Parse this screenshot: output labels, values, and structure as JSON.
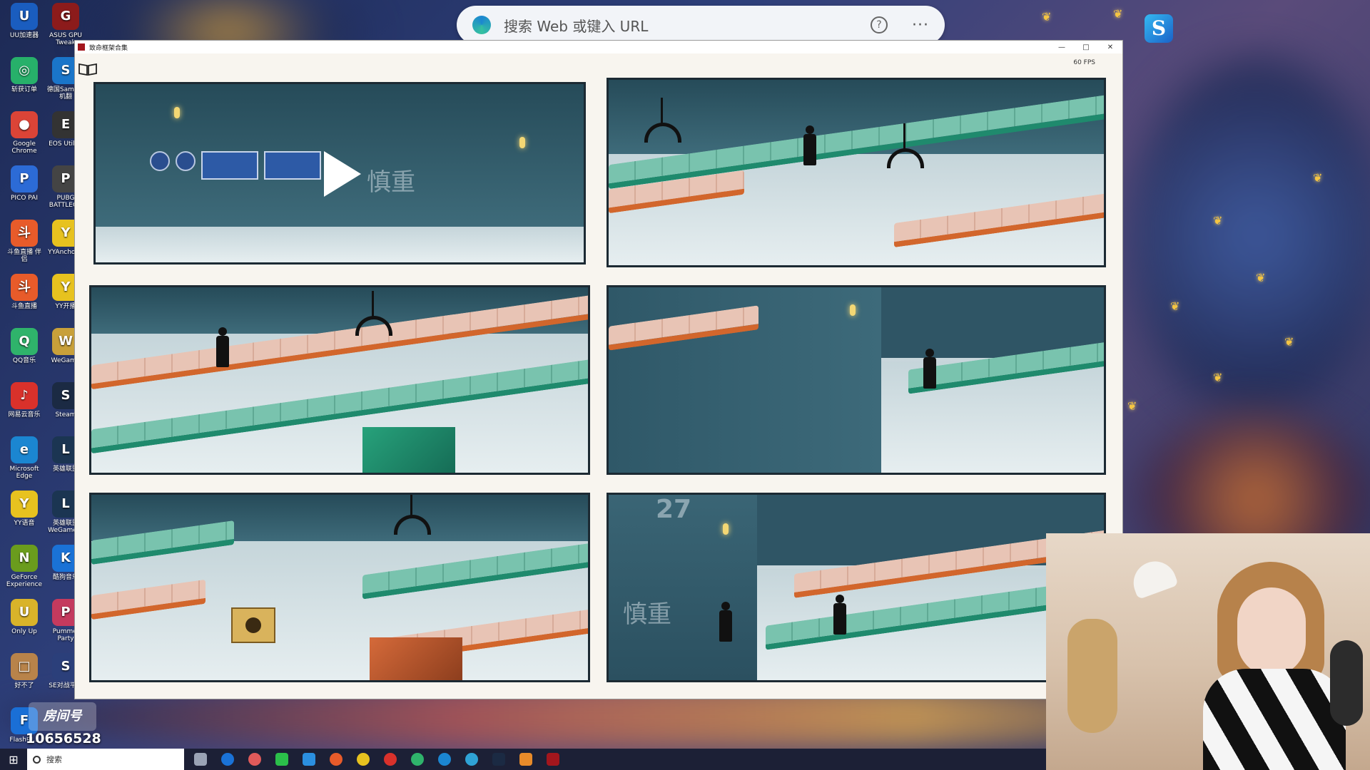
{
  "browser": {
    "address_placeholder": "搜索 Web 或键入 URL",
    "help_symbol": "?",
    "more_symbol": "···"
  },
  "desktop": {
    "icons": [
      {
        "label": "UU加速器",
        "color": "#1a5dbf",
        "glyph": "U"
      },
      {
        "label": "ASUS GPU Tweak",
        "color": "#8c1b1b",
        "glyph": "G"
      },
      {
        "label": "斩获订单",
        "color": "#27b06a",
        "glyph": "◎"
      },
      {
        "label": "德国SamPro 机翻",
        "color": "#1a75c9",
        "glyph": "S"
      },
      {
        "label": "Google Chrome",
        "color": "#db4437",
        "glyph": "●"
      },
      {
        "label": "EOS Utility",
        "color": "#333",
        "glyph": "E"
      },
      {
        "label": "PICO PAI",
        "color": "#2c6bd6",
        "glyph": "P"
      },
      {
        "label": "PUBG BATTLEGR",
        "color": "#444",
        "glyph": "P"
      },
      {
        "label": "斗鱼直播 伴侣",
        "color": "#e85b2a",
        "glyph": "斗"
      },
      {
        "label": "YYAnchor...",
        "color": "#e7c21f",
        "glyph": "Y"
      },
      {
        "label": "斗鱼直播",
        "color": "#e85b2a",
        "glyph": "斗"
      },
      {
        "label": "YY开播",
        "color": "#e7c21f",
        "glyph": "Y"
      },
      {
        "label": "QQ音乐",
        "color": "#2fb36b",
        "glyph": "Q"
      },
      {
        "label": "WeGame",
        "color": "#c8a03a",
        "glyph": "W"
      },
      {
        "label": "网易云音乐",
        "color": "#d9312b",
        "glyph": "♪"
      },
      {
        "label": "Steam",
        "color": "#1b2a43",
        "glyph": "S"
      },
      {
        "label": "Microsoft Edge",
        "color": "#1b86d1",
        "glyph": "e"
      },
      {
        "label": "英雄联盟",
        "color": "#1b3552",
        "glyph": "L"
      },
      {
        "label": "YY语音",
        "color": "#e7c21f",
        "glyph": "Y"
      },
      {
        "label": "英雄联盟 WeGame版",
        "color": "#1b3552",
        "glyph": "L"
      },
      {
        "label": "GeForce Experience",
        "color": "#6a9c1d",
        "glyph": "N"
      },
      {
        "label": "酷狗音乐",
        "color": "#1a72d6",
        "glyph": "K"
      },
      {
        "label": "Only Up",
        "color": "#d9b32a",
        "glyph": "U"
      },
      {
        "label": "Pummel Party",
        "color": "#c43a5e",
        "glyph": "P"
      },
      {
        "label": "好不了",
        "color": "#b8834a",
        "glyph": "□"
      },
      {
        "label": "SE对战平台",
        "color": "#2b3f7a",
        "glyph": "S"
      },
      {
        "label": "Flash中...",
        "color": "#1a6fd6",
        "glyph": "F"
      }
    ],
    "room_label": "房间号",
    "room_number": "10656528"
  },
  "window": {
    "title": "致命框架合集",
    "fps": "60 FPS",
    "minimize": "—",
    "maximize": "□",
    "close": "✕"
  },
  "comic": {
    "wall_sign_text": "慎重",
    "wall_number": "27"
  },
  "taskbar": {
    "search_placeholder": "搜索"
  }
}
